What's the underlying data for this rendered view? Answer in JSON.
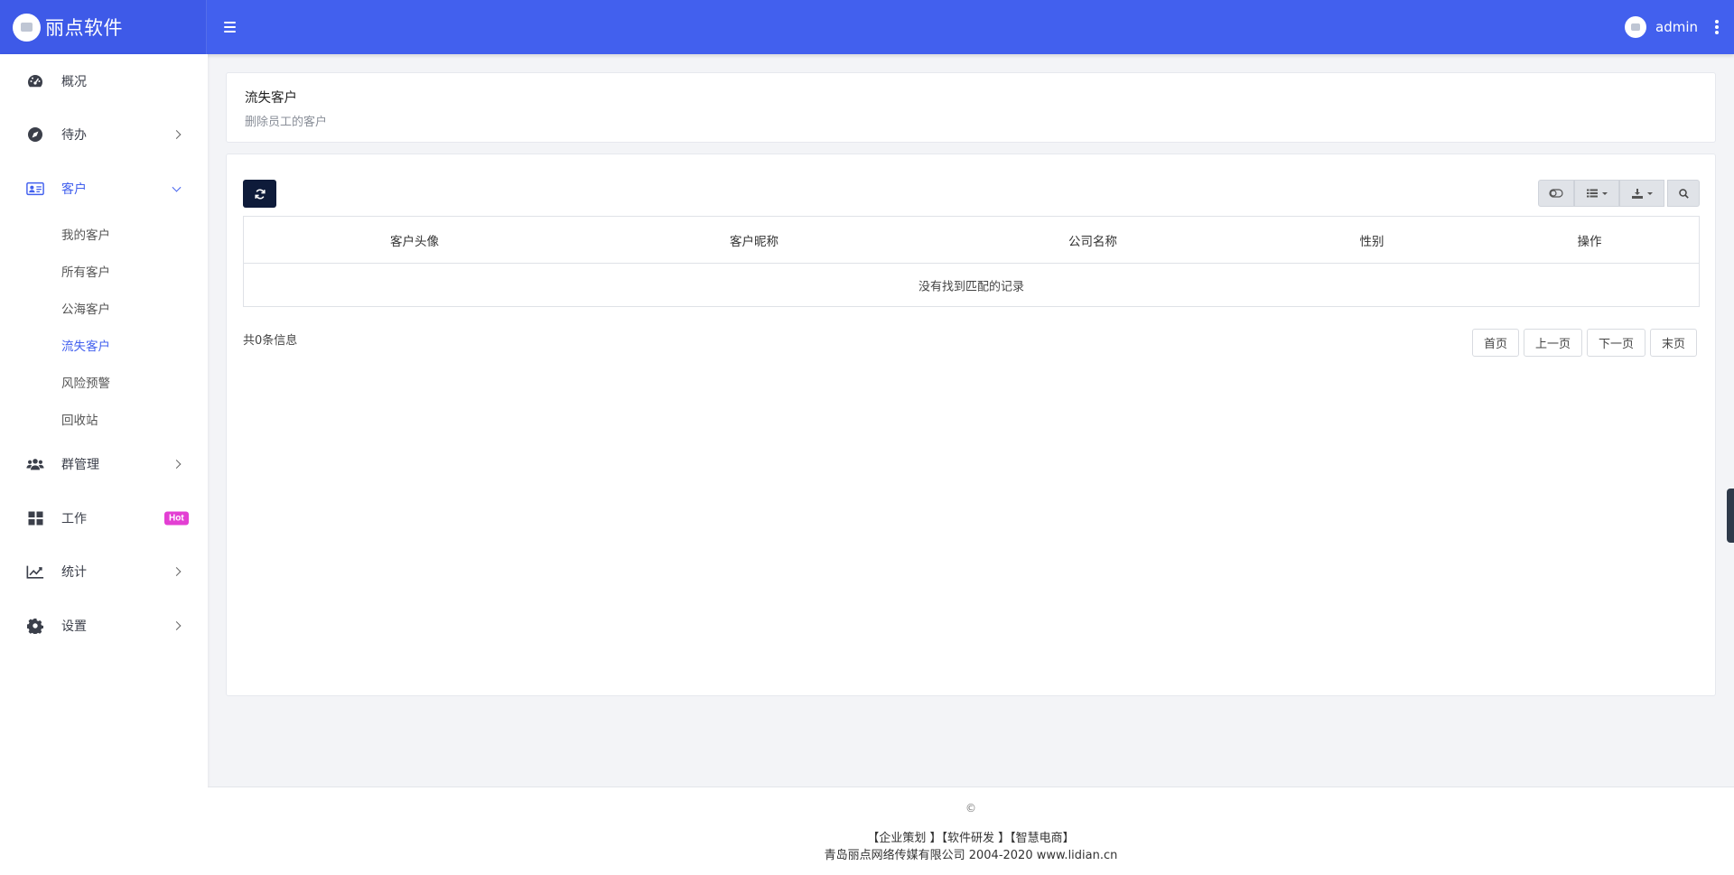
{
  "brand": {
    "name": "丽点软件"
  },
  "user": {
    "name": "admin"
  },
  "sidebar": {
    "items": [
      {
        "label": "概况"
      },
      {
        "label": "待办"
      },
      {
        "label": "客户"
      },
      {
        "label": "群管理"
      },
      {
        "label": "工作",
        "badge": "Hot"
      },
      {
        "label": "统计"
      },
      {
        "label": "设置"
      }
    ],
    "customer_sub": [
      {
        "label": "我的客户"
      },
      {
        "label": "所有客户"
      },
      {
        "label": "公海客户"
      },
      {
        "label": "流失客户"
      },
      {
        "label": "风险预警"
      },
      {
        "label": "回收站"
      }
    ]
  },
  "page": {
    "title": "流失客户",
    "subtitle": "删除员工的客户"
  },
  "table": {
    "columns": [
      "客户头像",
      "客户昵称",
      "公司名称",
      "性别",
      "操作"
    ],
    "empty_text": "没有找到匹配的记录",
    "total_text": "共0条信息"
  },
  "pager": {
    "first": "首页",
    "prev": "上一页",
    "next": "下一页",
    "last": "末页"
  },
  "footer": {
    "copyright": "©",
    "links": "【企业策划 】【软件研发 】【智慧电商】",
    "company": "青岛丽点网络传媒有限公司 2004-2020 www.lidian.cn"
  },
  "colors": {
    "primary": "#4260ee",
    "dark_button": "#0e1b3a",
    "hot_badge": "#e33fd3"
  }
}
